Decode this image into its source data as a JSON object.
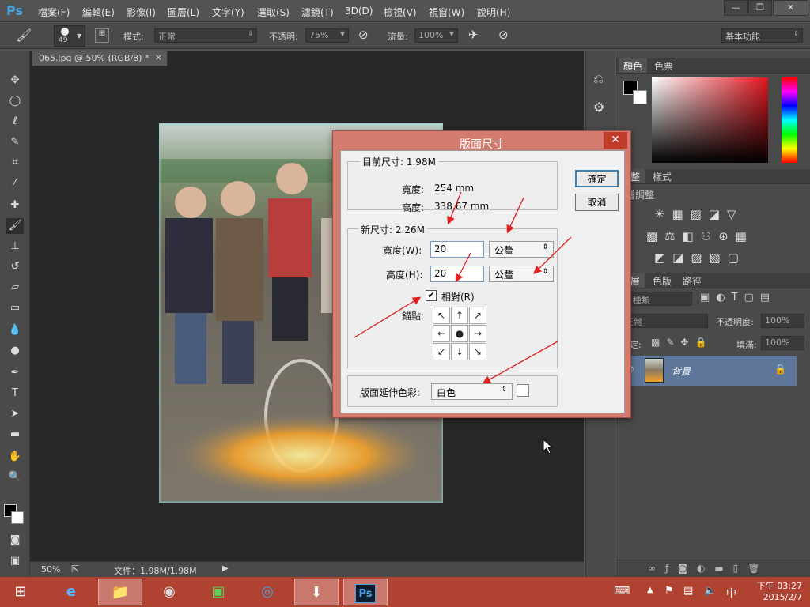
{
  "app": {
    "logo": "Ps"
  },
  "menu": [
    "檔案(F)",
    "編輯(E)",
    "影像(I)",
    "圖層(L)",
    "文字(Y)",
    "選取(S)",
    "濾鏡(T)",
    "3D(D)",
    "檢視(V)",
    "視窗(W)",
    "說明(H)"
  ],
  "window_controls": {
    "minimize": "—",
    "restore": "❐",
    "close": "✕"
  },
  "options_bar": {
    "brush_size": "49",
    "mode_label": "模式:",
    "mode_value": "正常",
    "opacity_label": "不透明:",
    "opacity_value": "75%",
    "flow_label": "流量:",
    "flow_value": "100%",
    "workspace": "基本功能"
  },
  "document": {
    "tab_title": "065.jpg @ 50% (RGB/8) *",
    "tab_close": "×"
  },
  "status": {
    "zoom": "50%",
    "file_info": "文件：1.98M/1.98M"
  },
  "panels": {
    "color_tabs": [
      "顏色",
      "色票"
    ],
    "adjust_tabs": [
      "調整",
      "樣式"
    ],
    "adjust_title": "新增調整",
    "layers_tabs": [
      "圖層",
      "色版",
      "路徑"
    ],
    "layer_kind": "種類",
    "blend_mode": "正常",
    "opacity_label": "不透明度:",
    "opacity_value": "100%",
    "lock_label": "鎖定:",
    "fill_label": "填滿:",
    "fill_value": "100%",
    "layer_name": "背景"
  },
  "dialog": {
    "title": "版面尺寸",
    "close": "✕",
    "current_group": "目前尺寸: 1.98M",
    "current_width_label": "寬度:",
    "current_width_value": "254 mm",
    "current_height_label": "高度:",
    "current_height_value": "338.67 mm",
    "new_group": "新尺寸: 2.26M",
    "width_label": "寬度(W):",
    "width_value": "20",
    "width_unit": "公釐",
    "height_label": "高度(H):",
    "height_value": "20",
    "height_unit": "公釐",
    "relative_label": "相對(R)",
    "relative_checked": true,
    "anchor_label": "錨點:",
    "anchor_arrows": [
      "↖",
      "↑",
      "↗",
      "←",
      "●",
      "→",
      "↙",
      "↓",
      "↘"
    ],
    "ext_color_label": "版面延伸色彩:",
    "ext_color_value": "白色",
    "ok": "確定",
    "cancel": "取消"
  },
  "taskbar": {
    "time": "下午 03:27",
    "date": "2015/2/7",
    "ime": "中"
  },
  "colors": {
    "dialog_frame": "#d27b6e",
    "annotation_arrow": "#e02020",
    "taskbar": "#b04232",
    "layer_selected": "#5d7699"
  }
}
